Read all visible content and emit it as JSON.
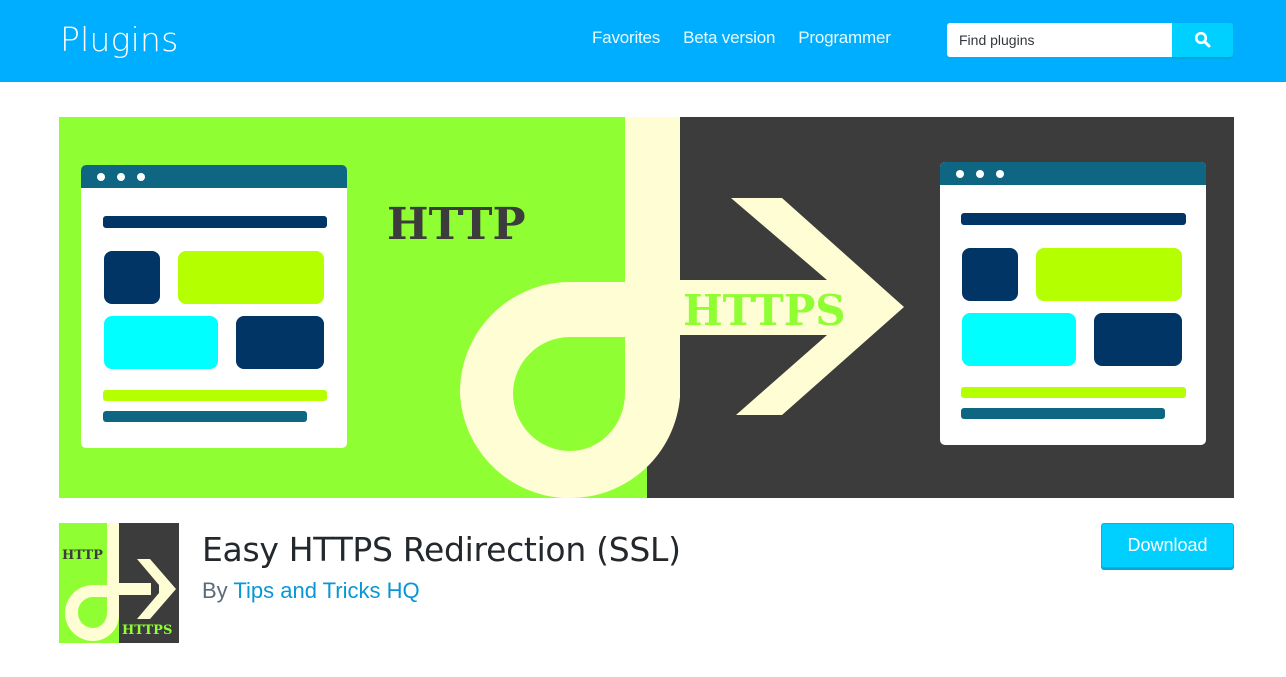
{
  "header": {
    "site_title": "Plugins",
    "nav": [
      {
        "label": "Favorites"
      },
      {
        "label": "Beta version"
      },
      {
        "label": "Programmer"
      }
    ],
    "search": {
      "placeholder": "Find plugins",
      "value": "",
      "button_icon": "search-icon"
    }
  },
  "banner": {
    "left_label": "HTTP",
    "right_label": "HTTPS",
    "colors": {
      "green_bg": "#8fff33",
      "dark_bg": "#3c3c3c",
      "cream": "#fffdd4",
      "browser_bar": "#0f6682",
      "navy": "#003566",
      "lime": "#b4ff00",
      "cyan": "#00ffff"
    }
  },
  "plugin": {
    "name": "Easy HTTPS Redirection (SSL)",
    "by_prefix": "By",
    "author": "Tips and Tricks HQ",
    "icon_labels": {
      "top": "HTTP",
      "bottom": "HTTPS"
    },
    "download_label": "Download"
  },
  "colors": {
    "header_bg": "#00aeff",
    "accent_button": "#00d0ff",
    "link": "#0a96d6",
    "text": "#23282d"
  }
}
